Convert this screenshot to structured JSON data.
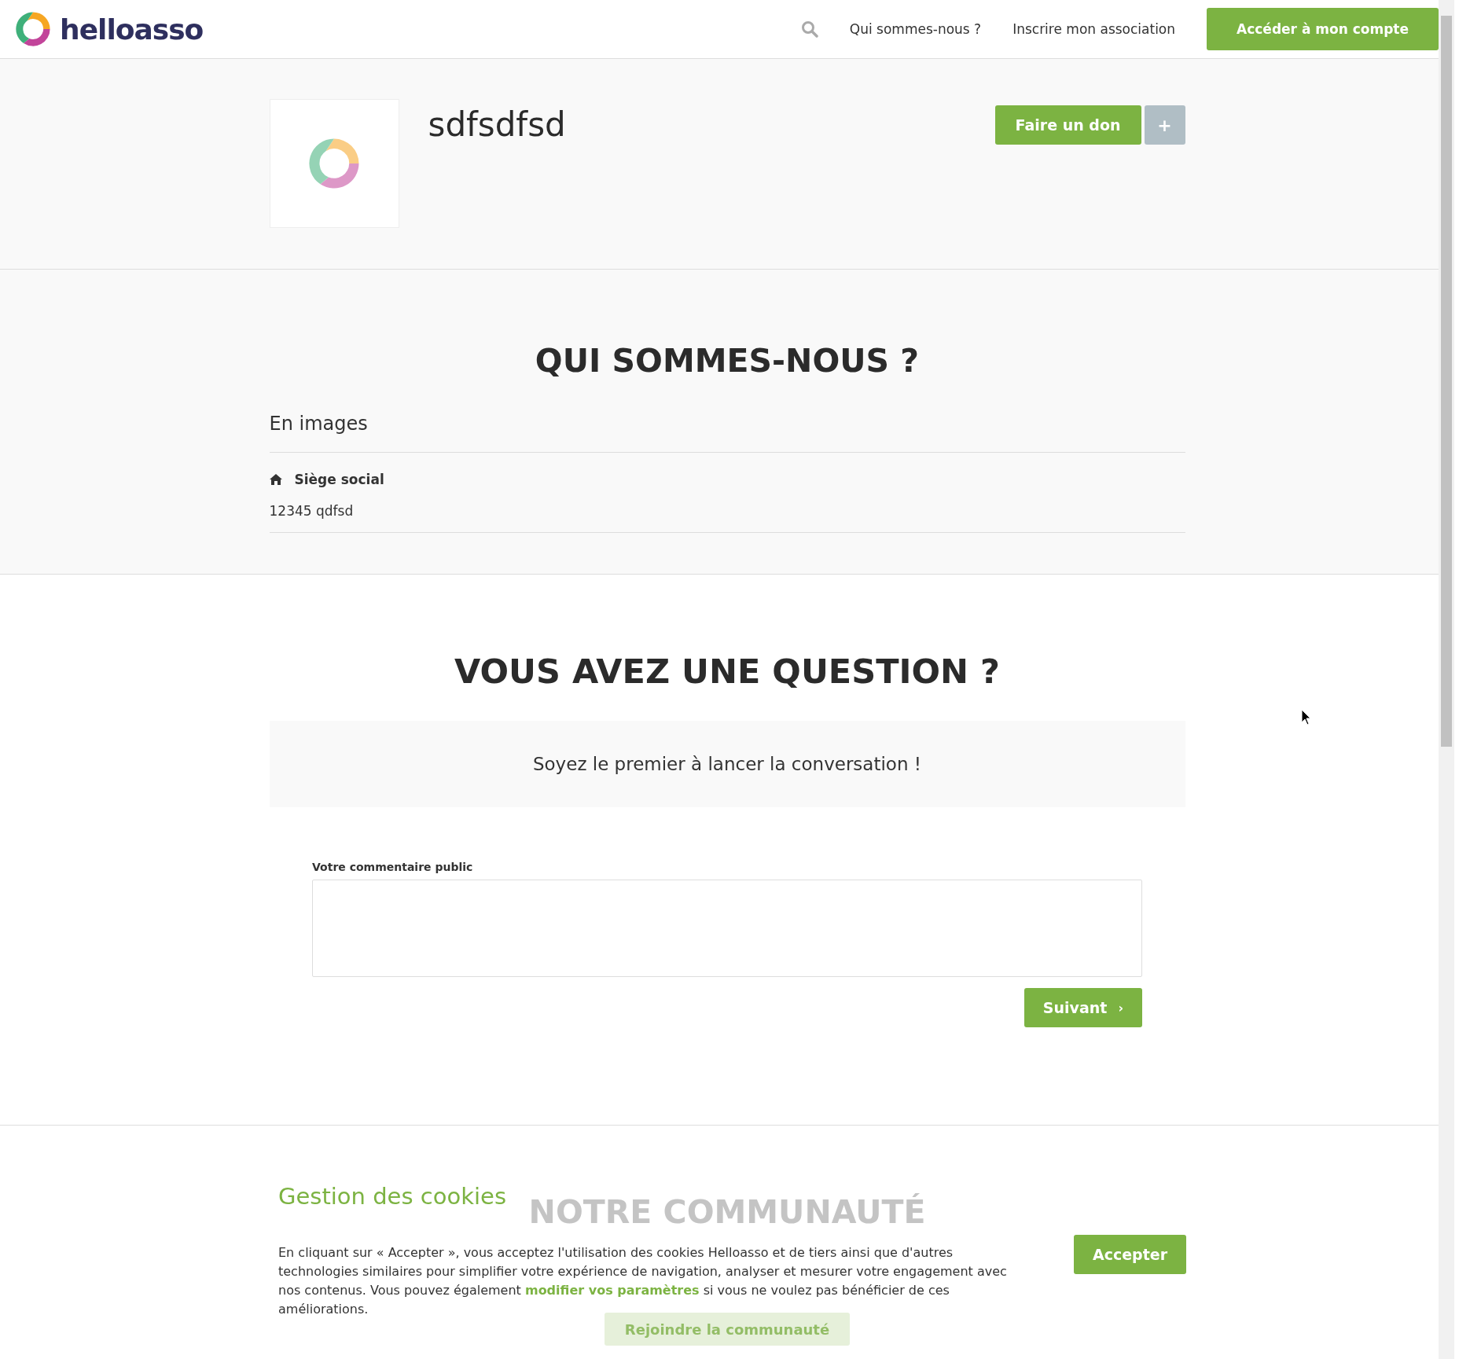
{
  "header": {
    "brand": "helloasso",
    "nav": [
      "Qui sommes-nous ?",
      "Inscrire mon association"
    ],
    "account_button": "Accéder à mon compte"
  },
  "organization": {
    "name": "sdfsdfsd",
    "donate_button": "Faire un don",
    "more_button": "+"
  },
  "about": {
    "heading": "QUI SOMMES-NOUS ?",
    "images_title": "En images",
    "address_label": "Siège social",
    "address": "12345 qdfsd"
  },
  "questions": {
    "heading": "VOUS AVEZ UNE QUESTION ?",
    "empty_message": "Soyez le premier à lancer la conversation !",
    "comment_label": "Votre commentaire public",
    "next_button": "Suivant",
    "next_arrow": "›"
  },
  "community": {
    "heading": "NOTRE COMMUNAUTÉ",
    "join_button": "Rejoindre la communauté"
  },
  "cookie_banner": {
    "title": "Gestion des cookies",
    "text": "En cliquant sur « Accepter », vous acceptez l'utilisation des cookies Helloasso et de tiers ainsi que d'autres technologies similaires pour simplifier votre expérience de navigation, analyser et mesurer votre engagement avec nos contenus. Vous pouvez également ",
    "link": "modifier vos paramètres",
    "text_after": " si vous ne voulez pas bénéficier de ces améliorations.",
    "accept_button": "Accepter"
  }
}
